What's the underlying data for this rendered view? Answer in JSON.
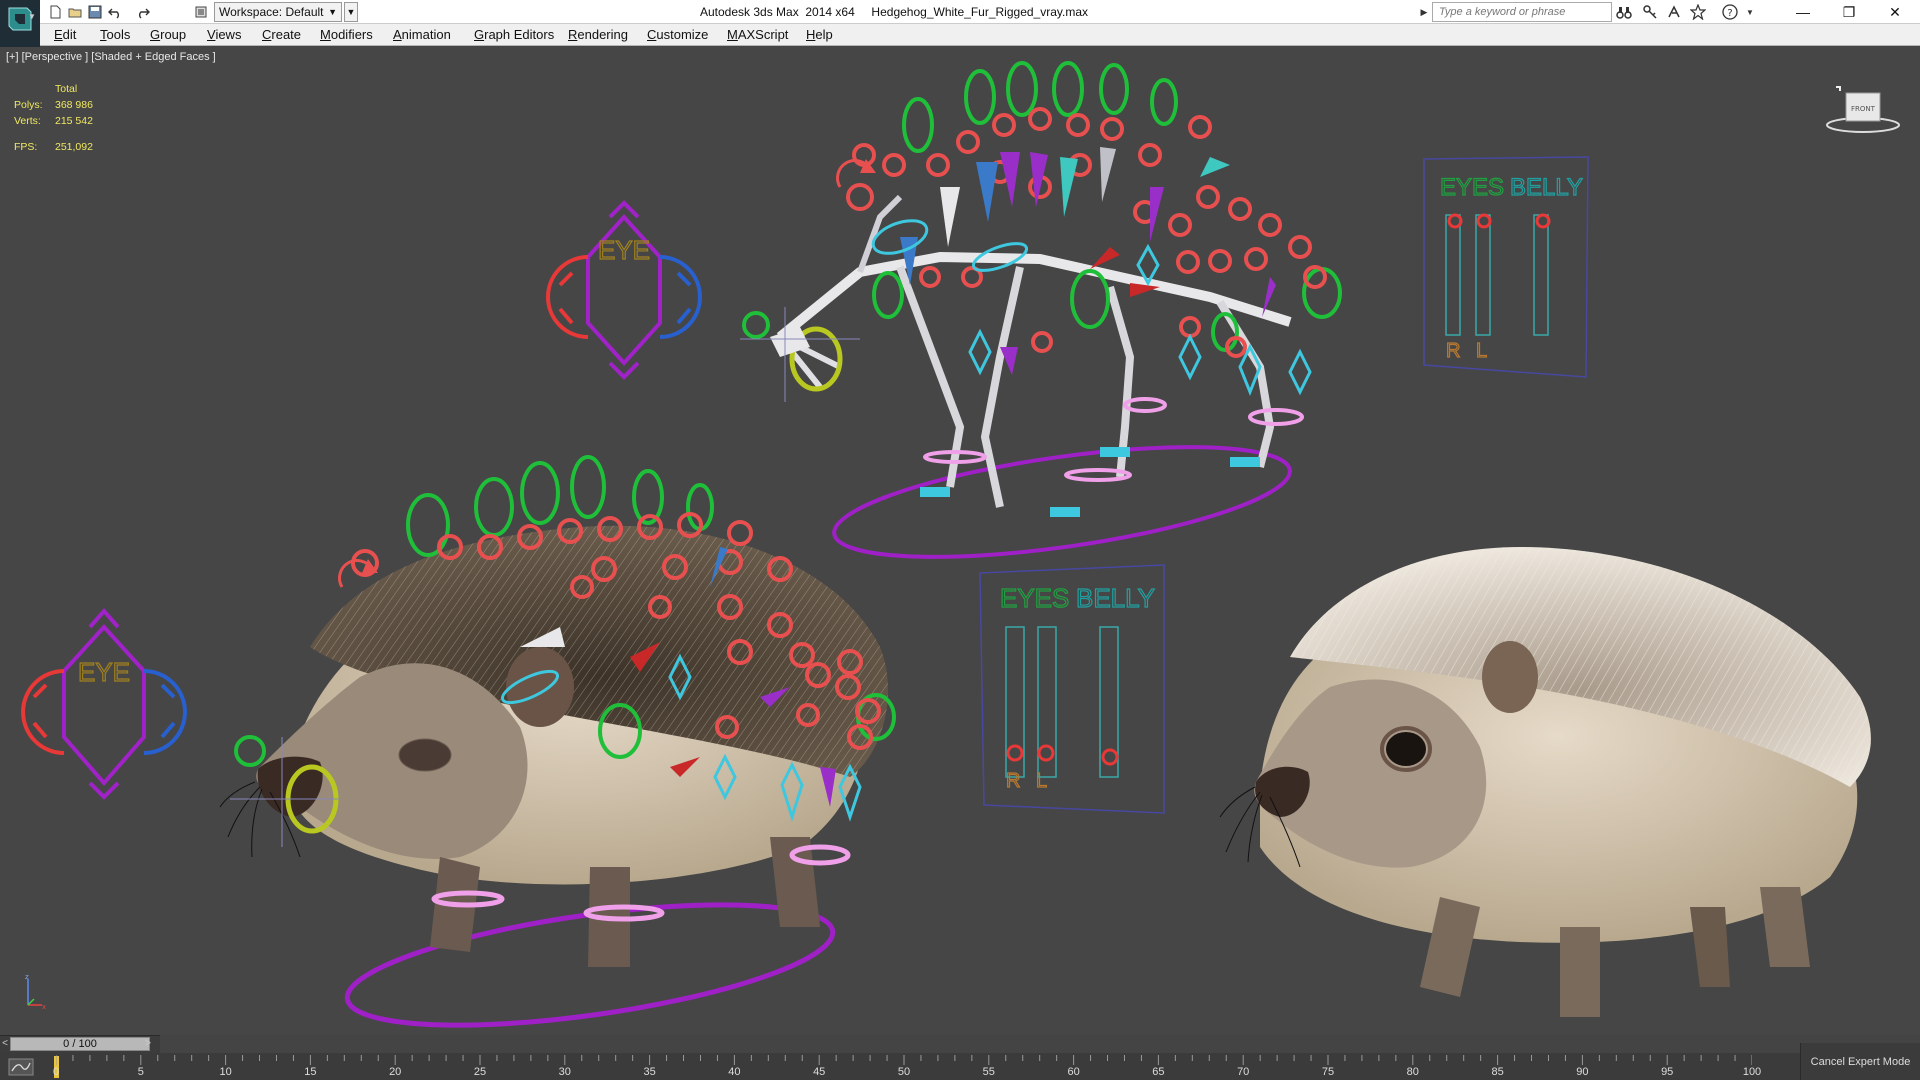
{
  "titlebar": {
    "workspace_label": "Workspace: Default",
    "window_title": "Autodesk 3ds Max  2014 x64     Hedgehog_White_Fur_Rigged_vray.max",
    "search_placeholder": "Type a keyword or phrase",
    "minimize": "—",
    "restore": "❐",
    "close": "✕"
  },
  "menu": {
    "items": [
      "Edit",
      "Tools",
      "Group",
      "Views",
      "Create",
      "Modifiers",
      "Animation",
      "Graph Editors",
      "Rendering",
      "Customize",
      "MAXScript",
      "Help"
    ]
  },
  "viewport": {
    "label": "[+] [Perspective ] [Shaded + Edged Faces ]",
    "stats": {
      "header": "Total",
      "polys_label": "Polys:",
      "polys_value": "368 986",
      "verts_label": "Verts:",
      "verts_value": "215 542",
      "fps_label": "FPS:",
      "fps_value": "251,092"
    },
    "viewcube_label": "FRONT",
    "eye_label_1": "EYE",
    "eye_label_2": "EYE",
    "panel1": {
      "eyes": "EYES",
      "belly": "BELLY",
      "r": "R",
      "l": "L"
    },
    "panel2": {
      "eyes": "EYES",
      "belly": "BELLY",
      "r": "R",
      "l": "L"
    },
    "colors": {
      "background": "#464646",
      "fur_tan": "#c9b8a0",
      "spines": "#5a4c3c",
      "control_green": "#1fbf3a",
      "control_red": "#e85050",
      "control_purple": "#a22ec8",
      "control_cyan": "#3ec8e0",
      "control_pink": "#f0a0e8"
    }
  },
  "timeline": {
    "slider_label": "0 / 100",
    "prev": "<",
    "next": ">",
    "ticks": [
      "0",
      "5",
      "10",
      "15",
      "20",
      "25",
      "30",
      "35",
      "40",
      "45",
      "50",
      "55",
      "60",
      "65",
      "70",
      "75",
      "80",
      "85",
      "90",
      "95",
      "100"
    ],
    "cancel_expert": "Cancel Expert Mode"
  }
}
